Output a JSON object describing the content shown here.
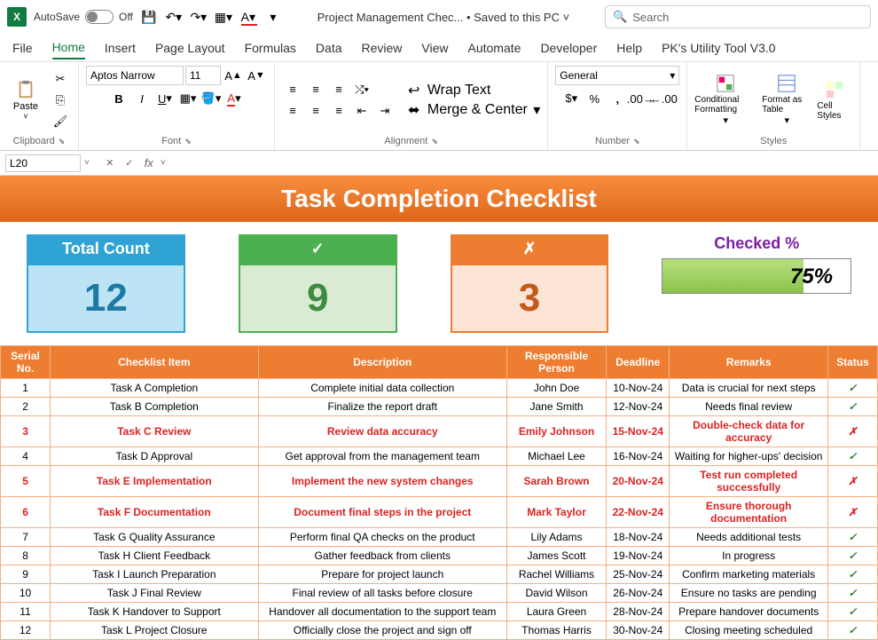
{
  "titlebar": {
    "autosave": "AutoSave",
    "autosave_state": "Off",
    "doc_title": "Project Management Chec...  •  Saved to this PC ˅",
    "search_placeholder": "Search"
  },
  "tabs": [
    "File",
    "Home",
    "Insert",
    "Page Layout",
    "Formulas",
    "Data",
    "Review",
    "View",
    "Automate",
    "Developer",
    "Help",
    "PK's Utility Tool V3.0"
  ],
  "active_tab": 1,
  "ribbon": {
    "clipboard": {
      "label": "Clipboard",
      "paste": "Paste"
    },
    "font": {
      "label": "Font",
      "font_name": "Aptos Narrow",
      "font_size": "11"
    },
    "alignment": {
      "label": "Alignment",
      "wrap": "Wrap Text",
      "merge": "Merge & Center"
    },
    "number": {
      "label": "Number",
      "format": "General"
    },
    "styles": {
      "label": "Styles",
      "cond": "Conditional Formatting",
      "fmt_table": "Format as Table",
      "cell": "Cell Styles"
    }
  },
  "namebox": "L20",
  "banner": "Task Completion Checklist",
  "cards": {
    "total_label": "Total Count",
    "total_value": "12",
    "done_symbol": "✓",
    "done_value": "9",
    "pend_symbol": "✗",
    "pend_value": "3",
    "checked_label": "Checked %",
    "checked_pct": "75%",
    "checked_fill": 75
  },
  "table": {
    "headers": [
      "Serial No.",
      "Checklist Item",
      "Description",
      "Responsible Person",
      "Deadline",
      "Remarks",
      "Status"
    ],
    "rows": [
      {
        "sn": "1",
        "item": "Task A Completion",
        "desc": "Complete initial data collection",
        "person": "John Doe",
        "deadline": "10-Nov-24",
        "remarks": "Data is crucial for next steps",
        "status": "ok",
        "red": false
      },
      {
        "sn": "2",
        "item": "Task B Completion",
        "desc": "Finalize the report draft",
        "person": "Jane Smith",
        "deadline": "12-Nov-24",
        "remarks": "Needs final review",
        "status": "ok",
        "red": false
      },
      {
        "sn": "3",
        "item": "Task C Review",
        "desc": "Review data accuracy",
        "person": "Emily Johnson",
        "deadline": "15-Nov-24",
        "remarks": "Double-check data for accuracy",
        "status": "no",
        "red": true
      },
      {
        "sn": "4",
        "item": "Task D Approval",
        "desc": "Get approval from the management team",
        "person": "Michael Lee",
        "deadline": "16-Nov-24",
        "remarks": "Waiting for higher-ups' decision",
        "status": "ok",
        "red": false
      },
      {
        "sn": "5",
        "item": "Task E Implementation",
        "desc": "Implement the new system changes",
        "person": "Sarah Brown",
        "deadline": "20-Nov-24",
        "remarks": "Test run completed successfully",
        "status": "no",
        "red": true
      },
      {
        "sn": "6",
        "item": "Task F Documentation",
        "desc": "Document final steps in the project",
        "person": "Mark Taylor",
        "deadline": "22-Nov-24",
        "remarks": "Ensure thorough documentation",
        "status": "no",
        "red": true
      },
      {
        "sn": "7",
        "item": "Task G Quality Assurance",
        "desc": "Perform final QA checks on the product",
        "person": "Lily Adams",
        "deadline": "18-Nov-24",
        "remarks": "Needs additional tests",
        "status": "ok",
        "red": false
      },
      {
        "sn": "8",
        "item": "Task H Client Feedback",
        "desc": "Gather feedback from clients",
        "person": "James Scott",
        "deadline": "19-Nov-24",
        "remarks": "In progress",
        "status": "ok",
        "red": false
      },
      {
        "sn": "9",
        "item": "Task I Launch Preparation",
        "desc": "Prepare for project launch",
        "person": "Rachel Williams",
        "deadline": "25-Nov-24",
        "remarks": "Confirm marketing materials",
        "status": "ok",
        "red": false
      },
      {
        "sn": "10",
        "item": "Task J Final Review",
        "desc": "Final review of all tasks before closure",
        "person": "David Wilson",
        "deadline": "26-Nov-24",
        "remarks": "Ensure no tasks are pending",
        "status": "ok",
        "red": false
      },
      {
        "sn": "11",
        "item": "Task K Handover to Support",
        "desc": "Handover all documentation to the support team",
        "person": "Laura Green",
        "deadline": "28-Nov-24",
        "remarks": "Prepare handover documents",
        "status": "ok",
        "red": false
      },
      {
        "sn": "12",
        "item": "Task L Project Closure",
        "desc": "Officially close the project and sign off",
        "person": "Thomas Harris",
        "deadline": "30-Nov-24",
        "remarks": "Closing meeting scheduled",
        "status": "ok",
        "red": false
      }
    ]
  }
}
